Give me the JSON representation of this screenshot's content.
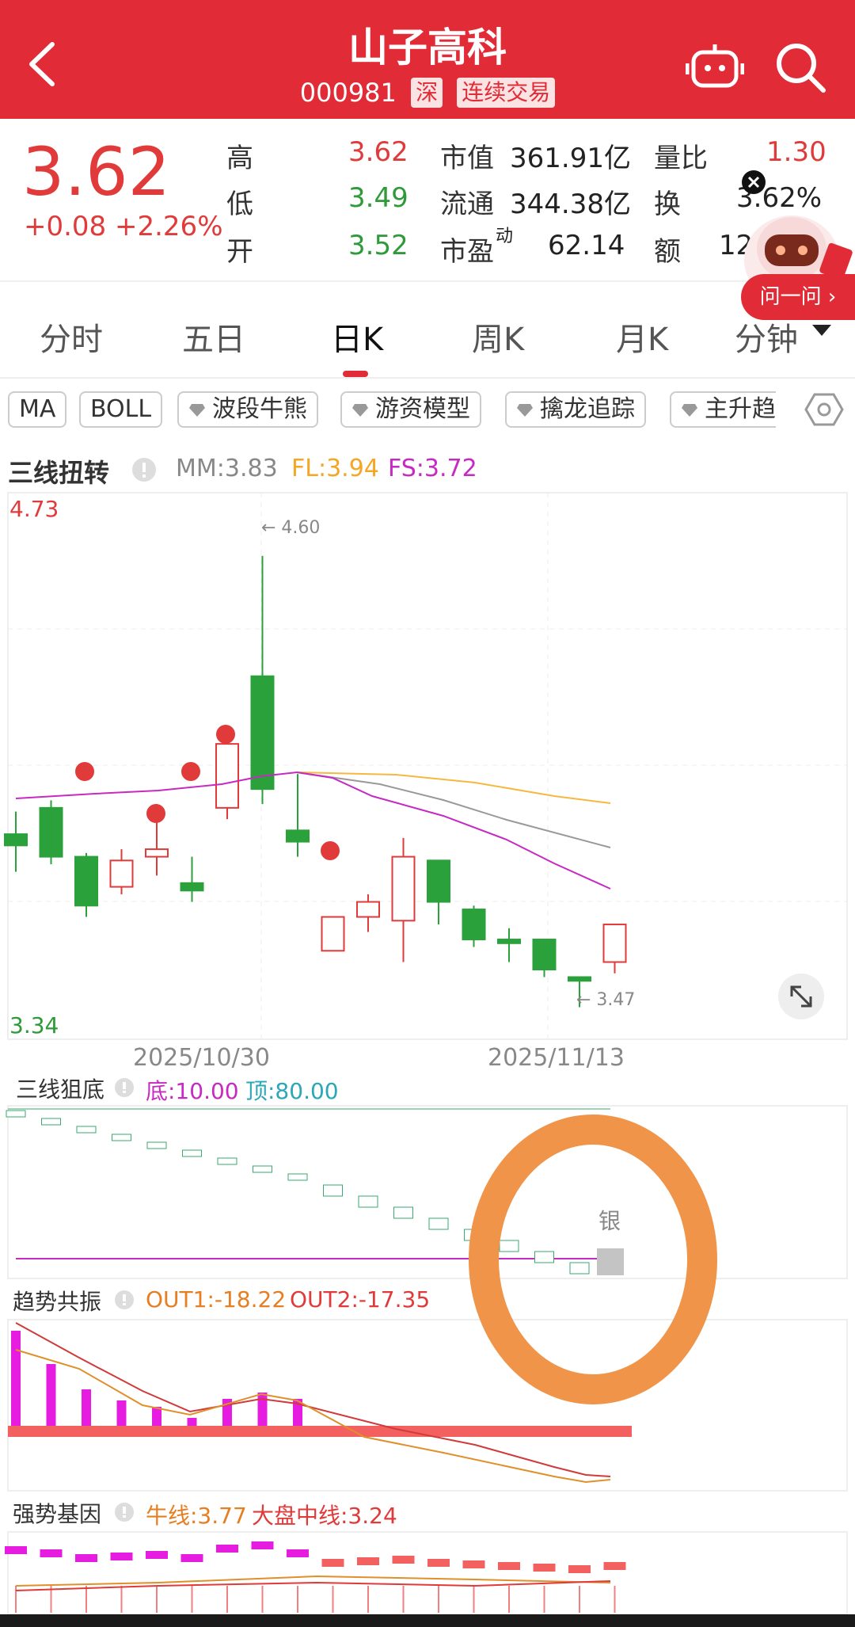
{
  "header": {
    "title": "山子高科",
    "code": "000981",
    "market": "深",
    "trade_mode": "连续交易",
    "bg": "#e12c37"
  },
  "quote": {
    "price": "3.62",
    "change": "+0.08 +2.26%",
    "high_label": "高",
    "high": "3.62",
    "low_label": "低",
    "low": "3.49",
    "open_label": "开",
    "open": "3.52",
    "mcap_label": "市值",
    "mcap": "361.91亿",
    "float_label": "流通",
    "float": "344.38亿",
    "pe_label": "市盈",
    "pe_sup": "动",
    "pe": "62.14",
    "vr_label": "量比",
    "vr": "1.30",
    "turn_label": "换",
    "turn": "3.62%",
    "amt_label": "额",
    "amt": "12."
  },
  "assistant": {
    "ask_label": "问一问 ›"
  },
  "tabs": [
    "分时",
    "五日",
    "日K",
    "周K",
    "月K",
    "分钟"
  ],
  "active_tab": 2,
  "indicators": [
    "MA",
    "BOLL",
    "波段牛熊",
    "游资模型",
    "擒龙追踪",
    "主升趋"
  ],
  "main_chart": {
    "title": "三线扭转",
    "mm": "MM:3.83",
    "fl": "FL:3.94",
    "fs": "FS:3.72",
    "ymax": "4.73",
    "ymin": "3.34",
    "high_mark": "← 4.60",
    "low_mark": "← 3.47",
    "date1": "2025/10/30",
    "date2": "2025/11/13"
  },
  "sub1": {
    "title": "三线狙底",
    "di": "底:10.00",
    "ding": "顶:80.00",
    "silver": "银"
  },
  "sub2": {
    "title": "趋势共振",
    "out1": "OUT1:-18.22",
    "out2": "OUT2:-17.35"
  },
  "sub3": {
    "title": "强势基因",
    "niu": "牛线:3.77",
    "dapan": "大盘中线:3.24"
  },
  "chart_data": {
    "type": "candlestick",
    "ylim": [
      3.34,
      4.73
    ],
    "candles": [
      {
        "o": 3.86,
        "c": 3.83,
        "h": 3.92,
        "l": 3.76
      },
      {
        "o": 3.93,
        "c": 3.8,
        "h": 3.95,
        "l": 3.78
      },
      {
        "o": 3.8,
        "c": 3.67,
        "h": 3.81,
        "l": 3.64
      },
      {
        "o": 3.72,
        "c": 3.79,
        "h": 3.82,
        "l": 3.7
      },
      {
        "o": 3.8,
        "c": 3.82,
        "h": 3.94,
        "l": 3.75
      },
      {
        "o": 3.73,
        "c": 3.71,
        "h": 3.8,
        "l": 3.68
      },
      {
        "o": 3.93,
        "c": 4.1,
        "h": 4.1,
        "l": 3.9
      },
      {
        "o": 4.28,
        "c": 3.98,
        "h": 4.6,
        "l": 3.94
      },
      {
        "o": 3.87,
        "c": 3.84,
        "h": 4.02,
        "l": 3.8
      },
      {
        "o": 3.55,
        "c": 3.64,
        "h": 3.64,
        "l": 3.55
      },
      {
        "o": 3.64,
        "c": 3.68,
        "h": 3.7,
        "l": 3.6
      },
      {
        "o": 3.63,
        "c": 3.8,
        "h": 3.85,
        "l": 3.52
      },
      {
        "o": 3.79,
        "c": 3.68,
        "h": 3.79,
        "l": 3.62
      },
      {
        "o": 3.66,
        "c": 3.58,
        "h": 3.67,
        "l": 3.56
      },
      {
        "o": 3.58,
        "c": 3.57,
        "h": 3.61,
        "l": 3.52
      },
      {
        "o": 3.58,
        "c": 3.5,
        "h": 3.58,
        "l": 3.48
      },
      {
        "o": 3.48,
        "c": 3.47,
        "h": 3.48,
        "l": 3.4
      },
      {
        "o": 3.52,
        "c": 3.62,
        "h": 3.62,
        "l": 3.49
      }
    ]
  }
}
